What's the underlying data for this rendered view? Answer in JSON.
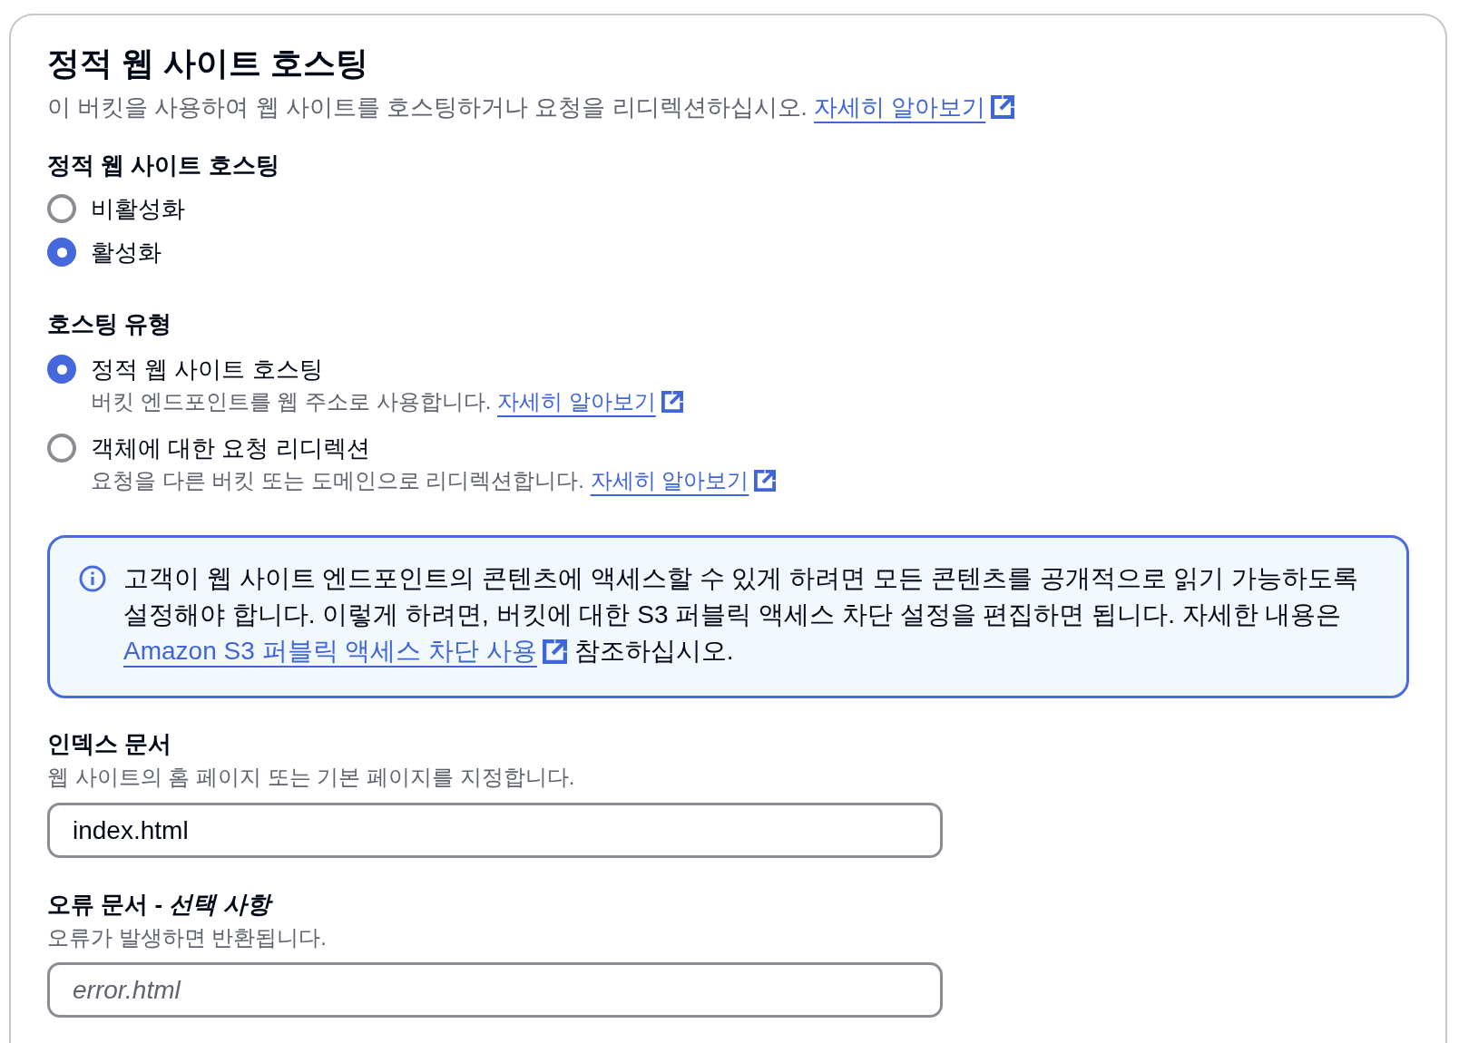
{
  "panel": {
    "title": "정적 웹 사이트 호스팅",
    "description": "이 버킷을 사용하여 웹 사이트를 호스팅하거나 요청을 리디렉션하십시오.",
    "link": "자세히 알아보기"
  },
  "hosting_toggle": {
    "label": "정적 웹 사이트 호스팅",
    "options": [
      {
        "label": "비활성화",
        "selected": false
      },
      {
        "label": "활성화",
        "selected": true
      }
    ]
  },
  "hosting_type": {
    "label": "호스팅 유형",
    "options": [
      {
        "label": "정적 웹 사이트 호스팅",
        "description": "버킷 엔드포인트를 웹 주소로 사용합니다.",
        "link": "자세히 알아보기",
        "selected": true
      },
      {
        "label": "객체에 대한 요청 리디렉션",
        "description": "요청을 다른 버킷 또는 도메인으로 리디렉션합니다.",
        "link": "자세히 알아보기",
        "selected": false
      }
    ]
  },
  "info_alert": {
    "text_before": "고객이 웹 사이트 엔드포인트의 콘텐츠에 액세스할 수 있게 하려면 모든 콘텐츠를 공개적으로 읽기 가능하도록 설정해야 합니다. 이렇게 하려면, 버킷에 대한 S3 퍼블릭 액세스 차단 설정을 편집하면 됩니다. 자세한 내용은",
    "link": "Amazon S3 퍼블릭 액세스 차단 사용",
    "text_after": "참조하십시오."
  },
  "index_document": {
    "label": "인덱스 문서",
    "description": "웹 사이트의 홈 페이지 또는 기본 페이지를 지정합니다.",
    "value": "index.html"
  },
  "error_document": {
    "label": "오류 문서 - *선택 사항*",
    "description": "오류가 발생하면 반환됩니다.",
    "placeholder": "error.html"
  }
}
